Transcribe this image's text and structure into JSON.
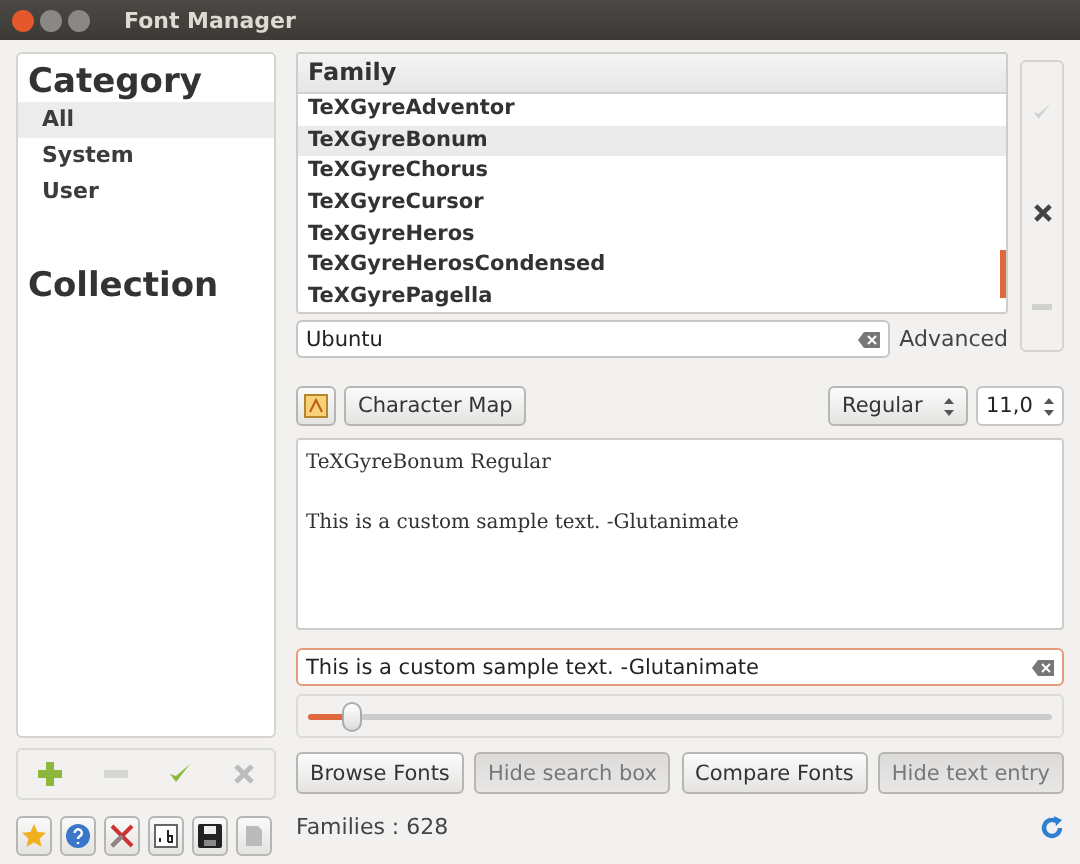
{
  "window": {
    "title": "Font Manager"
  },
  "category": {
    "title": "Category",
    "items": [
      {
        "label": "All",
        "selected": true
      },
      {
        "label": "System",
        "selected": false
      },
      {
        "label": "User",
        "selected": false
      }
    ]
  },
  "collection": {
    "title": "Collection"
  },
  "collection_toolbar": [
    {
      "kind": "add",
      "disabled": false
    },
    {
      "kind": "remove",
      "disabled": true
    },
    {
      "kind": "enable",
      "disabled": false
    },
    {
      "kind": "disable",
      "disabled": true
    }
  ],
  "family_list": {
    "header": "Family",
    "rows": [
      {
        "label": "TeXGyreAdventor",
        "selected": false
      },
      {
        "label": "TeXGyreBonum",
        "selected": true
      },
      {
        "label": "TeXGyreChorus",
        "selected": false
      },
      {
        "label": "TeXGyreCursor",
        "selected": false
      },
      {
        "label": "TeXGyreHeros",
        "selected": false
      },
      {
        "label": "TeXGyreHerosCondensed",
        "selected": false
      },
      {
        "label": "TeXGyrePagella",
        "selected": false
      }
    ]
  },
  "side_buttons": [
    {
      "kind": "enable",
      "disabled": true
    },
    {
      "kind": "disable",
      "disabled": false
    },
    {
      "kind": "remove",
      "disabled": true
    }
  ],
  "search": {
    "value": "Ubuntu"
  },
  "advanced": "Advanced",
  "character_map": "Character Map",
  "style_select": {
    "value": "Regular"
  },
  "size_field": {
    "value": "11,0"
  },
  "preview": {
    "title": "TeXGyreBonum Regular",
    "sample": "This is a custom sample text. -Glutanimate"
  },
  "text_entry": {
    "value": "This is a custom sample text. -Glutanimate"
  },
  "size_slider": {
    "level": 0.06
  },
  "buttons": [
    {
      "label": "Browse Fonts",
      "pressed": false
    },
    {
      "label": "Hide search box",
      "pressed": true
    },
    {
      "label": "Compare Fonts",
      "pressed": false
    },
    {
      "label": "Hide text entry",
      "pressed": true
    }
  ],
  "bottom_icons": [
    {
      "kind": "star"
    },
    {
      "kind": "help"
    },
    {
      "kind": "tools"
    },
    {
      "kind": "glyph"
    },
    {
      "kind": "save"
    },
    {
      "kind": "export"
    }
  ],
  "status": "Families : 628"
}
